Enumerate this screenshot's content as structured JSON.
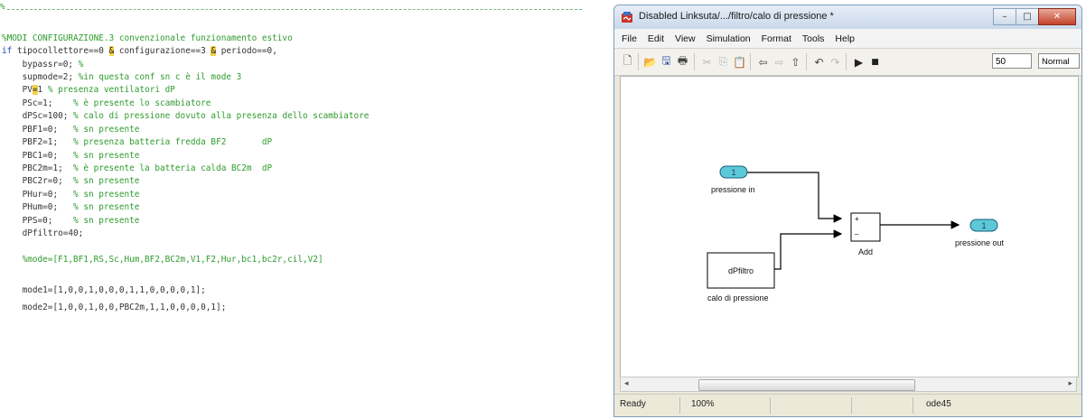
{
  "editor": {
    "dashes_lead": "%",
    "lines": [
      {
        "code": "",
        "comment": "%MODI CONFIGURAZIONE.3 convenzionale funzionamento estivo"
      },
      {
        "kw": "if",
        "code": " tipocollettore==0 ",
        "hl": "&",
        "code2": " configurazione==3 ",
        "hl2": "&",
        "code3": " periodo==0,"
      },
      {
        "code": "    bypassr=0; ",
        "comment": "%"
      },
      {
        "code": "    supmode=2; ",
        "comment": "%in questa conf sn c è il mode 3"
      },
      {
        "code": "    PV",
        "hl": "=",
        "code2": "1 ",
        "comment": "% presenza ventilatori dP"
      },
      {
        "code": "    PSc=1;    ",
        "comment": "% è presente lo scambiatore"
      },
      {
        "code": "    dPSc=100; ",
        "comment": "% calo di pressione dovuto alla presenza dello scambiatore"
      },
      {
        "code": "    PBF1=0;   ",
        "comment": "% sn presente"
      },
      {
        "code": "    PBF2=1;   ",
        "comment": "% presenza batteria fredda BF2       dP"
      },
      {
        "code": "    PBC1=0;   ",
        "comment": "% sn presente"
      },
      {
        "code": "    PBC2m=1;  ",
        "comment": "% è presente la batteria calda BC2m  dP"
      },
      {
        "code": "    PBC2r=0;  ",
        "comment": "% sn presente"
      },
      {
        "code": "    PHur=0;   ",
        "comment": "% sn presente"
      },
      {
        "code": "    PHum=0;   ",
        "comment": "% sn presente"
      },
      {
        "code": "    PPS=0;    ",
        "comment": "% sn presente"
      },
      {
        "code": "    dPfiltro=40;",
        "comment": ""
      },
      {
        "code": "",
        "comment": ""
      },
      {
        "code": "    ",
        "comment": "%mode=[F1,BF1,RS,Sc,Hum,BF2,BC2m,V1,F2,Hur,bc1,bc2r,cil,V2]"
      },
      {
        "code": "",
        "comment": ""
      },
      {
        "code": "    mode1=[1,0,0,1,0,0,0,1,1,0,0,0,0,1];",
        "comment": ""
      },
      {
        "code": "    mode2=[1,0,0,1,0,0,PBC2m,1,1,0,0,0,0,1];",
        "comment": ""
      }
    ]
  },
  "window": {
    "title": "Disabled Linksuta/.../filtro/calo di pressione *",
    "menu": [
      "File",
      "Edit",
      "View",
      "Simulation",
      "Format",
      "Tools",
      "Help"
    ],
    "stop_time": "50",
    "sim_mode": "Normal",
    "buttons": {
      "minimize": "–",
      "maximize": "□",
      "close": "✕"
    }
  },
  "diagram": {
    "inport": {
      "number": "1",
      "label": "pressione in"
    },
    "block_constant": {
      "value": "dPfiltro",
      "label": "calo di pressione"
    },
    "block_add": {
      "label": "Add",
      "signs": [
        "+",
        "–"
      ]
    },
    "outport": {
      "number": "1",
      "label": "pressione out"
    }
  },
  "status": {
    "ready": "Ready",
    "zoom": "100%",
    "solver": "ode45"
  },
  "colors": {
    "comment": "#2e9b2e",
    "keyword": "#1f3fc2",
    "highlight": "#f4d24a",
    "port": "#5cc8d8"
  }
}
